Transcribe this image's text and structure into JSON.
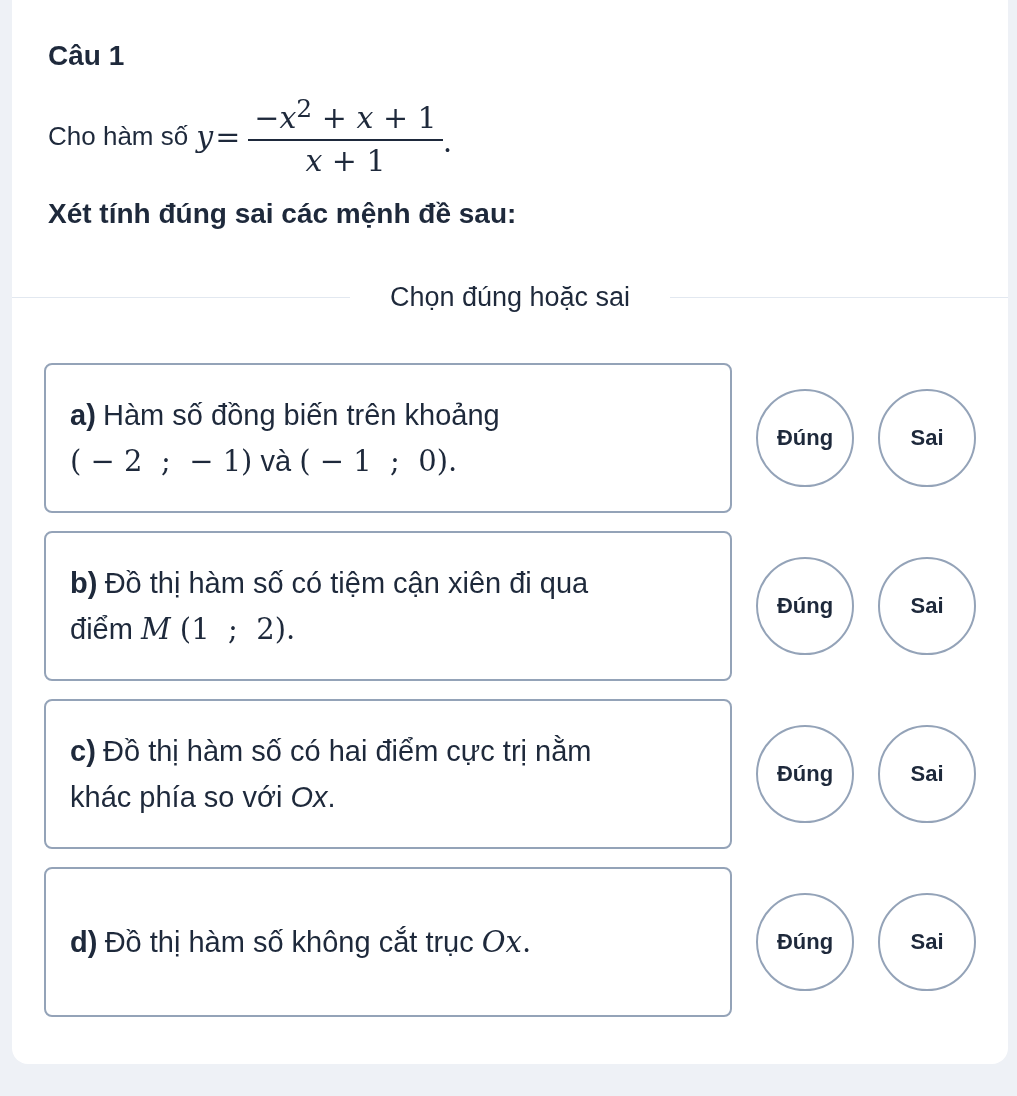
{
  "question": {
    "title": "Câu 1",
    "intro": "Cho hàm số",
    "function": {
      "variable": "y",
      "equals": "=",
      "numerator": "−*x*$^{2}$ + *x* + 1",
      "denominator": "*x* + 1",
      "end": "."
    },
    "instruction": "Xét tính đúng sai các mệnh đề sau:"
  },
  "divider": "Chọn đúng hoặc sai",
  "statements": [
    {
      "label": "a)",
      "lines": [
        [
          {
            "kind": "text",
            "text": "Hàm số đồng biến trên khoảng"
          }
        ],
        [
          {
            "kind": "math",
            "text": "( − 2  ;  − 1)"
          },
          {
            "kind": "text",
            "text": " và "
          },
          {
            "kind": "math",
            "text": "( − 1  ;  0)."
          }
        ]
      ],
      "choices": [
        {
          "label": "Đúng",
          "selected": false
        },
        {
          "label": "Sai",
          "selected": false
        }
      ]
    },
    {
      "label": "b)",
      "lines": [
        [
          {
            "kind": "text",
            "text": "Đồ thị hàm số có tiệm cận xiên đi qua"
          }
        ],
        [
          {
            "kind": "text",
            "text": "điểm "
          },
          {
            "kind": "math",
            "text": "*M* (1  ;  2)."
          }
        ]
      ],
      "choices": [
        {
          "label": "Đúng",
          "selected": false
        },
        {
          "label": "Sai",
          "selected": false
        }
      ]
    },
    {
      "label": "c)",
      "lines": [
        [
          {
            "kind": "text",
            "text": "Đồ thị hàm số có hai điểm cực trị nằm"
          }
        ],
        [
          {
            "kind": "text",
            "text": "khác phía so với *Ox*."
          }
        ]
      ],
      "choices": [
        {
          "label": "Đúng",
          "selected": false
        },
        {
          "label": "Sai",
          "selected": false
        }
      ]
    },
    {
      "label": "d)",
      "lines": [
        [
          {
            "kind": "text",
            "text": "Đồ thị hàm số không cắt trục "
          },
          {
            "kind": "math",
            "text": "*Ox*."
          }
        ]
      ],
      "choices": [
        {
          "label": "Đúng",
          "selected": false
        },
        {
          "label": "Sai",
          "selected": false
        }
      ]
    }
  ]
}
